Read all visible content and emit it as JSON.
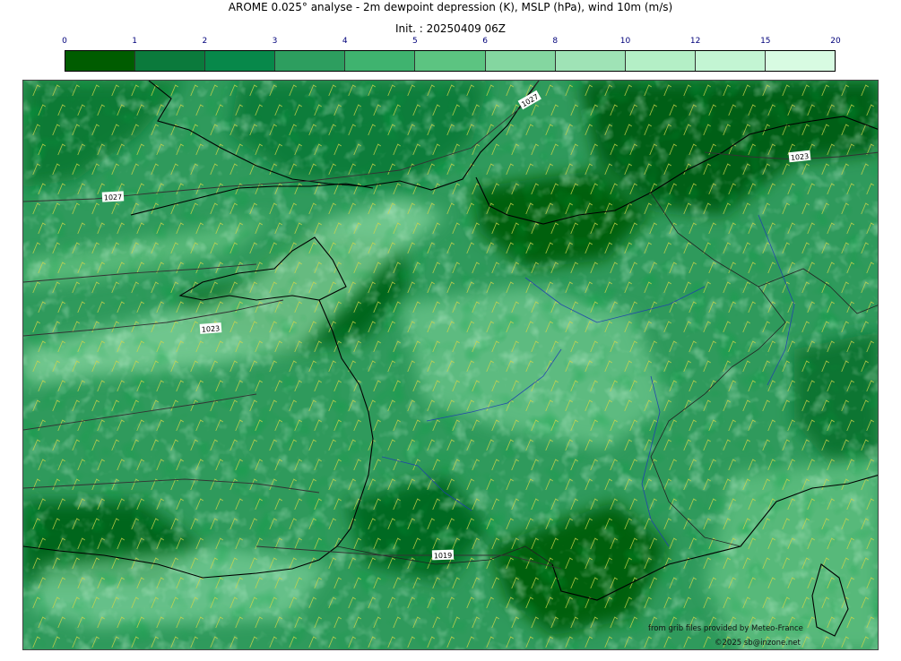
{
  "header": {
    "title": "AROME 0.025° analyse - 2m dewpoint depression (K), MSLP (hPa), wind 10m (m/s)",
    "init": "Init. : 20250409 06Z"
  },
  "colorbar": {
    "ticks": [
      "0",
      "1",
      "2",
      "3",
      "4",
      "5",
      "6",
      "8",
      "10",
      "12",
      "15",
      "20"
    ],
    "colors": [
      "#005c00",
      "#0b7a3c",
      "#07884a",
      "#2d9e5f",
      "#3fb36f",
      "#5cc481",
      "#84d6a0",
      "#9fe3b6",
      "#b4efc6",
      "#c3f5d3",
      "#d8fbe2"
    ]
  },
  "map": {
    "isobar_labels": [
      "1027",
      "1023",
      "1027",
      "1023",
      "1019"
    ],
    "credits": {
      "source": "from grib files provided by Meteo-France",
      "copyright": "©2025 sb@inzone.net"
    }
  }
}
